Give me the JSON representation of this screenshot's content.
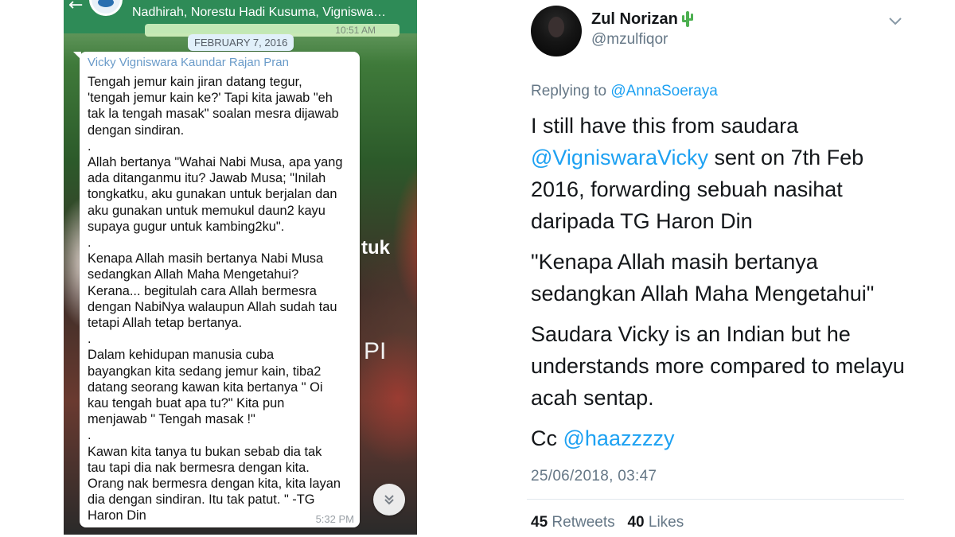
{
  "whatsapp": {
    "group_participants": "Nadhirah, Norestu Hadi Kusuma, Vigniswa…",
    "previous_message_time": "10:51 AM",
    "date_divider": "FEBRUARY 7, 2016",
    "message": {
      "sender": "Vicky Vigniswara Kaundar Rajan Pran",
      "text": "Tengah jemur kain jiran datang tegur,\n'tengah jemur kain ke?' Tapi kita jawab \"eh\ntak la tengah masak\" soalan mesra dijawab\ndengan sindiran.\n.\nAllah bertanya \"Wahai Nabi Musa, apa yang\nada ditanganmu itu? Jawab Musa; \"Inilah\ntongkatku, aku gunakan untuk berjalan dan\naku gunakan untuk memukul daun2 kayu\nsupaya gugur untuk kambing2ku\".\n.\nKenapa Allah masih bertanya Nabi Musa\nsedangkan Allah Maha Mengetahui?\nKerana... begitulah cara Allah bermesra\ndengan NabiNya walaupun Allah sudah tau\ntetapi Allah tetap bertanya.\n.\nDalam kehidupan manusia cuba\nbayangkan kita sedang jemur kain, tiba2\ndatang seorang kawan kita bertanya \" Oi\nkau tengah buat apa tu?\" Kita pun\nmenjawab \" Tengah masak !\"\n.\nKawan kita tanya tu bukan sebab dia tak\ntau tapi dia nak bermesra dengan kita.\nOrang nak bermesra dengan kita, kita layan\ndia dengan sindiran. Itu tak patut. \" -TG\nHaron Din",
      "time": "5:32 PM"
    },
    "background_text": [
      "tuk",
      "PI"
    ],
    "scroll_down_icon": "chevron-double-down-icon"
  },
  "tweet": {
    "display_name": "Zul Norizan",
    "name_emoji": "cactus-icon",
    "handle": "@mzulfiqor",
    "replying_to_label": "Replying to",
    "replying_to_handle": "@AnnaSoeraya",
    "para1": {
      "before": "I still have this from saudara",
      "mention": "@VigniswaraVicky",
      "after": " sent on 7th Feb 2016, forwarding sebuah nasihat daripada TG Haron Din"
    },
    "para2": "\"Kenapa Allah masih bertanya sedangkan Allah Maha Mengetahui\"",
    "para3": "Saudara Vicky is an Indian but he understands more compared to melayu acah sentap.",
    "para4": {
      "prefix": "Cc ",
      "mention": "@haazzzzy"
    },
    "timestamp": "25/06/2018, 03:47",
    "retweets_count": "45",
    "retweets_label": "Retweets",
    "likes_count": "40",
    "likes_label": "Likes",
    "colors": {
      "link": "#1da1f2",
      "secondary": "#657786",
      "text": "#14171a"
    }
  }
}
